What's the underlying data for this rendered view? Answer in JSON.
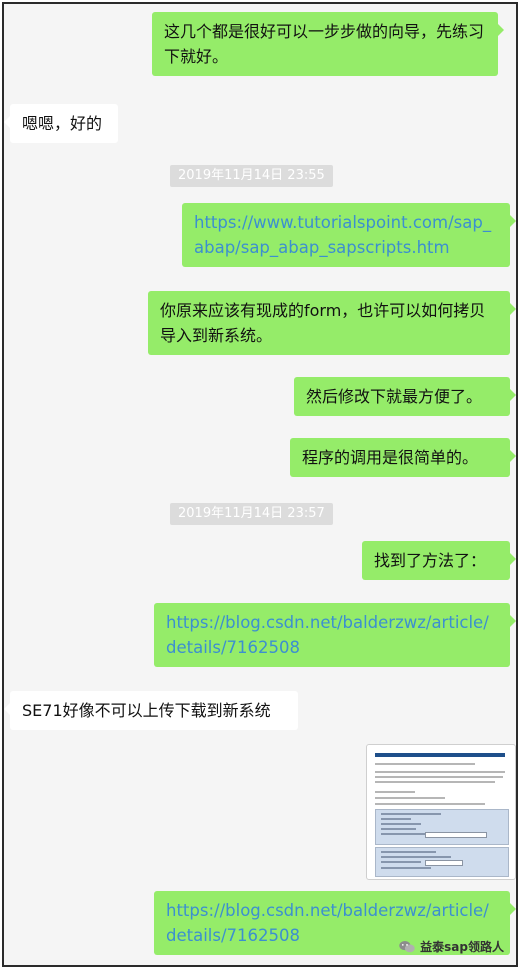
{
  "messages": [
    {
      "side": "right",
      "type": "text",
      "text": "这几个都是很好可以一步步做的向导，先练习下就好。"
    },
    {
      "side": "left",
      "type": "text",
      "text": "嗯嗯，好的"
    },
    {
      "type": "timestamp",
      "text": "2019年11月14日 23:55"
    },
    {
      "side": "right",
      "type": "link",
      "text": "https://www.tutorialspoint.com/sap_abap/sap_abap_sapscripts.htm"
    },
    {
      "side": "right",
      "type": "text",
      "text": "你原来应该有现成的form，也许可以如何拷贝导入到新系统。"
    },
    {
      "side": "right",
      "type": "text",
      "text": "然后修改下就最方便了。"
    },
    {
      "side": "right",
      "type": "text",
      "text": "程序的调用是很简单的。"
    },
    {
      "type": "timestamp",
      "text": "2019年11月14日 23:57"
    },
    {
      "side": "right",
      "type": "text",
      "text": "找到了方法了："
    },
    {
      "side": "right",
      "type": "link",
      "text": "https://blog.csdn.net/balderzwz/article/details/7162508"
    },
    {
      "side": "left",
      "type": "text",
      "text": "SE71好像不可以上传下载到新系统"
    },
    {
      "side": "left",
      "type": "image",
      "caption": "Download or Upload an SAP Script Form, Style and Standard Text"
    },
    {
      "side": "right",
      "type": "link",
      "text": "https://blog.csdn.net/balderzwz/article/details/7162508"
    }
  ],
  "watermark": {
    "text": "益泰sap领路人",
    "icon": "wechat-icon"
  },
  "colors": {
    "right_bubble": "#95ec69",
    "left_bubble": "#ffffff",
    "link": "#3c8fd0",
    "timestamp_bg": "#dcdcdc",
    "background": "#f5f5f5"
  }
}
